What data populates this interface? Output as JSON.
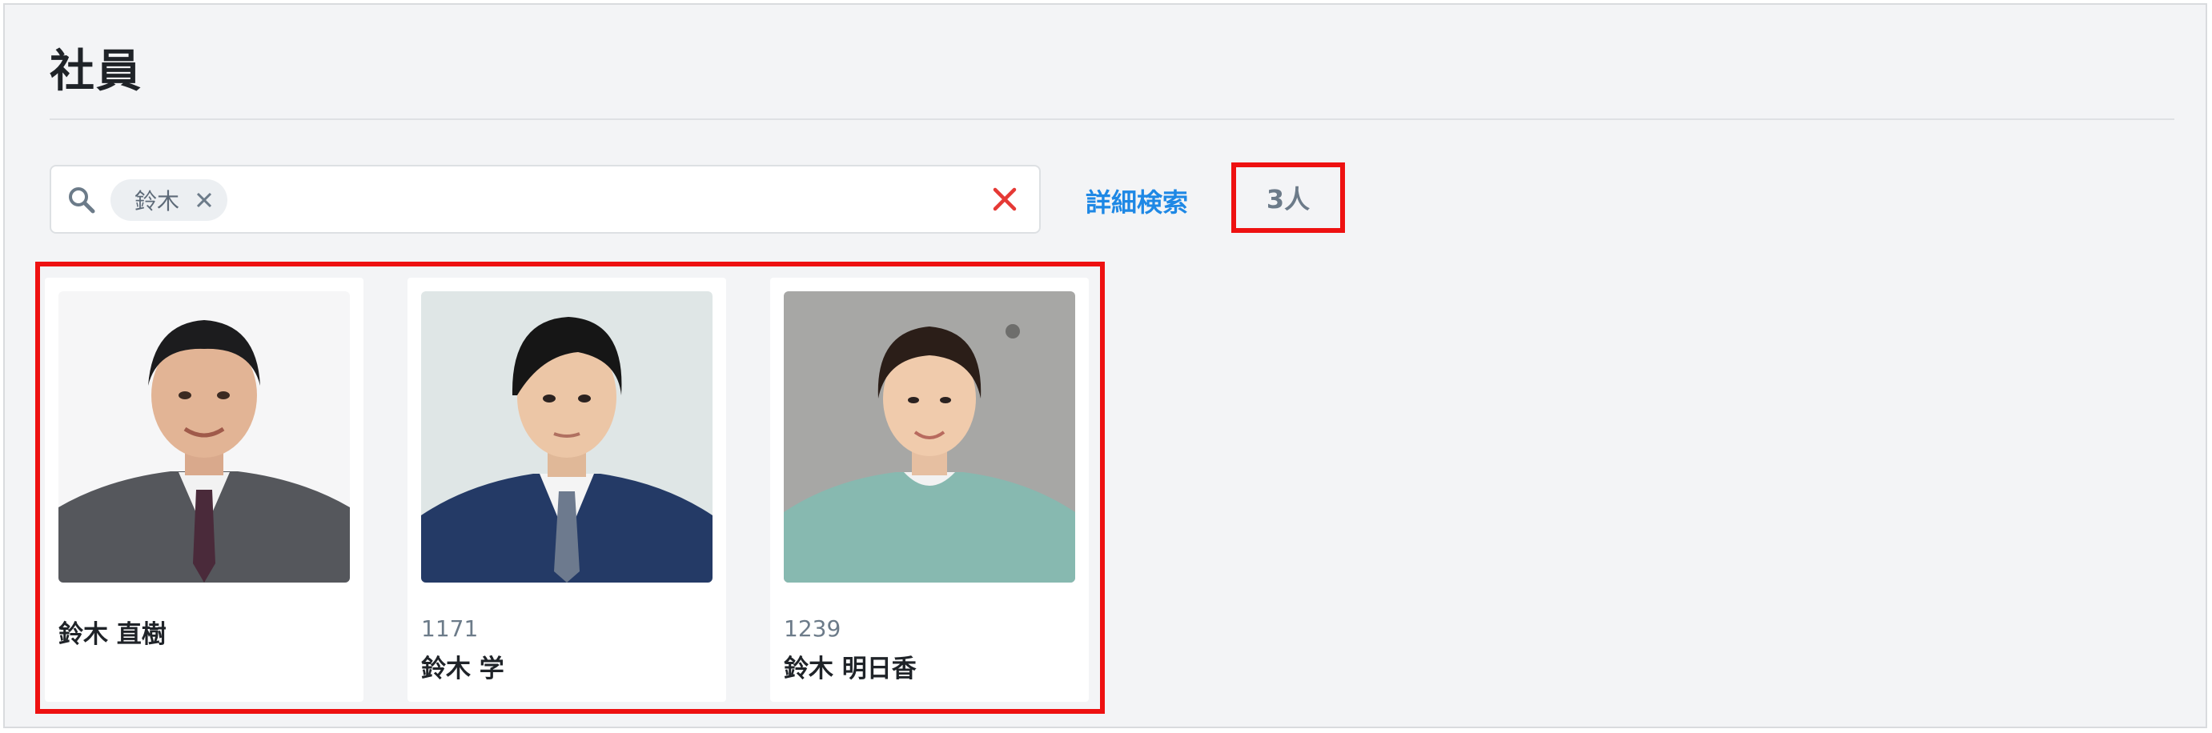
{
  "page": {
    "title": "社員"
  },
  "search": {
    "chip_label": "鈴木",
    "icon": "search-icon",
    "clear_icon": "close-icon",
    "advanced_link": "詳細検索",
    "result_count": "3人"
  },
  "colors": {
    "accent_link": "#1e88e5",
    "clear_x": "#e53935",
    "highlight": "#ee1111"
  },
  "employees": [
    {
      "id": "",
      "name": "鈴木 直樹"
    },
    {
      "id": "1171",
      "name": "鈴木 学"
    },
    {
      "id": "1239",
      "name": "鈴木 明日香"
    }
  ]
}
